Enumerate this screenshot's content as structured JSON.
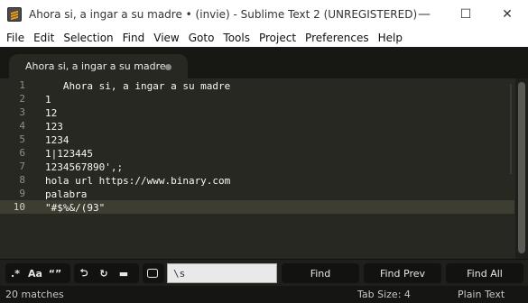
{
  "window": {
    "title": "Ahora si, a ingar a su madre • (invie) - Sublime Text 2 (UNREGISTERED)",
    "minimize_glyph": "—",
    "maximize_glyph": "☐",
    "close_glyph": "✕"
  },
  "menu": [
    "File",
    "Edit",
    "Selection",
    "Find",
    "View",
    "Goto",
    "Tools",
    "Project",
    "Preferences",
    "Help"
  ],
  "tab": {
    "label": "Ahora si, a ingar a su madre"
  },
  "editor": {
    "current_line": 10,
    "lines": [
      {
        "num": "1",
        "text": "   Ahora si, a ingar a su madre "
      },
      {
        "num": "2",
        "text": "1 "
      },
      {
        "num": "3",
        "text": "12 "
      },
      {
        "num": "4",
        "text": "123 "
      },
      {
        "num": "5",
        "text": "1234 "
      },
      {
        "num": "6",
        "text": "1|123445 "
      },
      {
        "num": "7",
        "text": "1234567890',;"
      },
      {
        "num": "8",
        "text": "hola url https://www.binary.com "
      },
      {
        "num": "9",
        "text": "palabra "
      },
      {
        "num": "10",
        "text": "\"#$%&/(93\""
      }
    ]
  },
  "find_panel": {
    "regex_label": ".*",
    "case_label": "Aa",
    "word_label": "“”",
    "wrap_label": "⮌",
    "selection_label": "↻",
    "highlight_label": "▬",
    "search_value": "\\s",
    "find_label": "Find",
    "find_prev_label": "Find Prev",
    "find_all_label": "Find All"
  },
  "status": {
    "matches": "20 matches",
    "tab_size": "Tab Size: 4",
    "syntax": "Plain Text"
  }
}
